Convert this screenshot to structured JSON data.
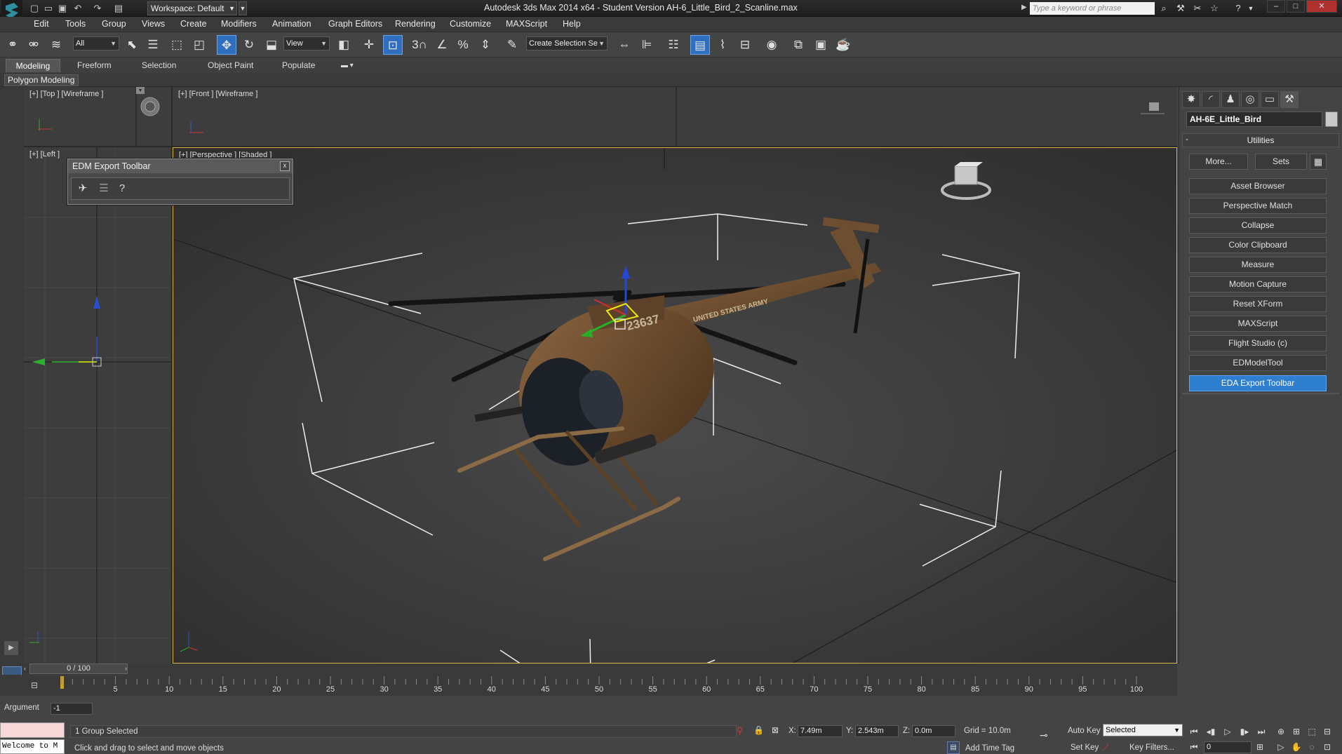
{
  "titlebar": {
    "workspace": "Workspace: Default",
    "title": "Autodesk 3ds Max  2014 x64    - Student Version    AH-6_Little_Bird_2_Scanline.max",
    "search_placeholder": "Type a keyword or phrase",
    "window_controls": [
      "–",
      "□",
      "✕"
    ]
  },
  "menu": [
    "Edit",
    "Tools",
    "Group",
    "Views",
    "Create",
    "Modifiers",
    "Animation",
    "Graph Editors",
    "Rendering",
    "Customize",
    "MAXScript",
    "Help"
  ],
  "main_toolbar": {
    "selection_filter": "All",
    "reference_coord": "View",
    "snap_3d_label": "3",
    "named_selection_placeholder": "Create Selection Se",
    "icons": [
      "link-icon",
      "unlink-icon",
      "bind-spacewarp-icon",
      "select-object-icon",
      "select-by-name-icon",
      "rect-select-icon",
      "window-crossing-icon",
      "select-move-icon",
      "select-rotate-icon",
      "select-scale-icon",
      "pivot-icon",
      "select-manipulate-icon",
      "keyboard-shortcut-icon",
      "snap-toggle-icon",
      "angle-snap-icon",
      "percent-snap-icon",
      "spinner-snap-icon",
      "edit-named-selection-icon",
      "mirror-icon",
      "align-icon",
      "layer-manager-icon",
      "graphite-ribbon-icon",
      "curve-editor-icon",
      "schematic-view-icon",
      "material-editor-icon",
      "render-setup-icon",
      "rendered-frame-icon",
      "render-production-icon"
    ]
  },
  "ribbon": {
    "tabs": [
      "Modeling",
      "Freeform",
      "Selection",
      "Object Paint",
      "Populate"
    ],
    "active_tab": "Modeling",
    "panel_label": "Polygon Modeling"
  },
  "viewports": {
    "top": "[+] [Top ] [Wireframe ]",
    "front": "[+] [Front ] [Wireframe ]",
    "left": "[+] [Left ]",
    "perspective": "[+] [Perspective ] [Shaded ]"
  },
  "edm_toolbar": {
    "title": "EDM Export Toolbar",
    "close": "x",
    "help": "?"
  },
  "helicopter": {
    "tail_number": "23637",
    "marking": "UNITED STATES ARMY"
  },
  "command_panel": {
    "object_name": "AH-6E_Little_Bird",
    "rollout_title": "Utilities",
    "rollout_toggle": "-",
    "more_button": "More...",
    "sets_button": "Sets",
    "utilities": [
      "Asset Browser",
      "Perspective Match",
      "Collapse",
      "Color Clipboard",
      "Measure",
      "Motion Capture",
      "Reset XForm",
      "MAXScript",
      "Flight Studio (c)",
      "EDModelTool",
      "EDA Export Toolbar"
    ],
    "active_utility": "EDA Export Toolbar",
    "colors": {
      "active": "#2f7fd1",
      "name_swatch": "#c9c9c9"
    }
  },
  "timeline": {
    "frame_display": "0 / 100",
    "ticks": [
      "5",
      "10",
      "15",
      "20",
      "25",
      "30",
      "35",
      "40",
      "45",
      "50",
      "55",
      "60",
      "65",
      "70",
      "75",
      "80",
      "85",
      "90",
      "95",
      "100"
    ]
  },
  "status": {
    "argument_label": "Argument",
    "argument_value": "-1",
    "listener_output": "Welcome to M",
    "selection_info": "1 Group Selected",
    "prompt": "Click and drag to select and move objects",
    "x_label": "X:",
    "x_value": "7.49m",
    "y_label": "Y:",
    "y_value": "2.543m",
    "z_label": "Z:",
    "z_value": "0.0m",
    "grid": "Grid = 10.0m",
    "auto_key": "Auto Key",
    "set_key": "Set Key",
    "key_mode": "Selected",
    "key_filters": "Key Filters...",
    "add_time_tag": "Add Time Tag",
    "current_frame": "0"
  }
}
